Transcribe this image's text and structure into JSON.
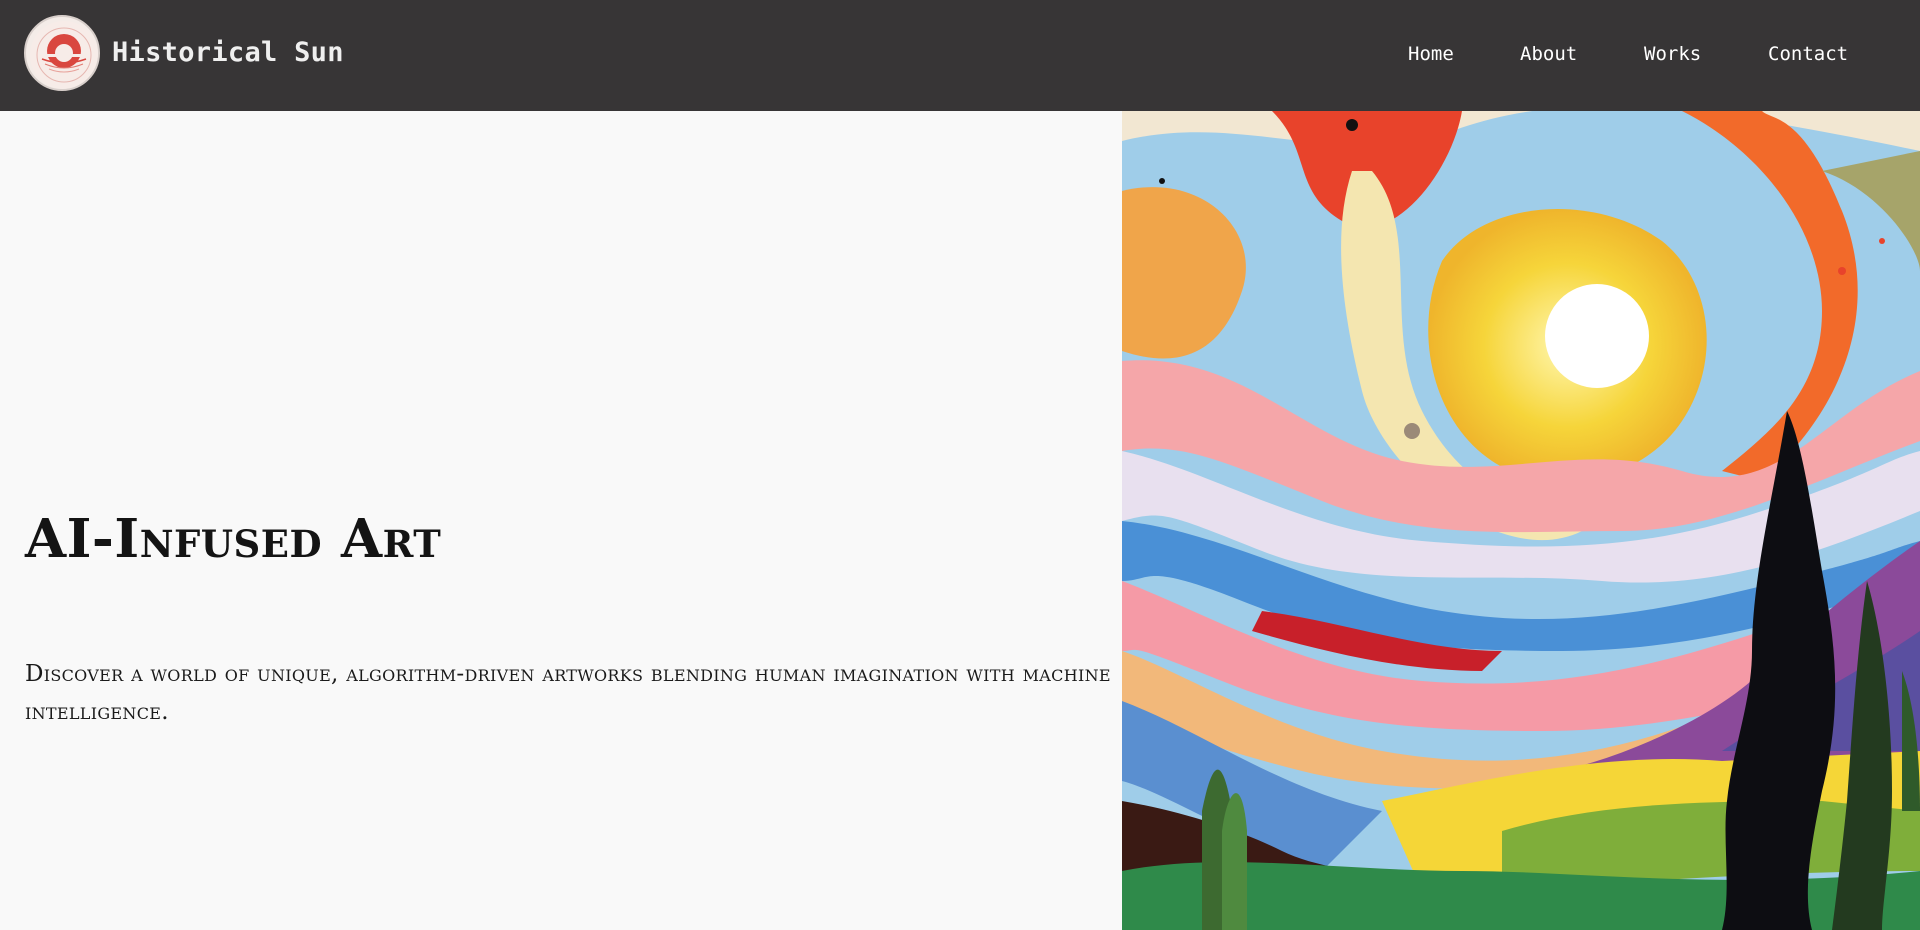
{
  "header": {
    "brand": "Historical Sun",
    "nav": [
      {
        "label": "Home"
      },
      {
        "label": "About"
      },
      {
        "label": "Works"
      },
      {
        "label": "Contact"
      }
    ]
  },
  "hero": {
    "title": "AI-Infused Art",
    "description": "Discover a world of unique, algorithm-driven artworks blending human imagination with machine intelligence."
  },
  "colors": {
    "header_bg": "#373536",
    "page_bg": "#f9f9f9",
    "logo_accent": "#d9473f"
  },
  "icons": {
    "logo": "red-sun-logo-icon"
  }
}
